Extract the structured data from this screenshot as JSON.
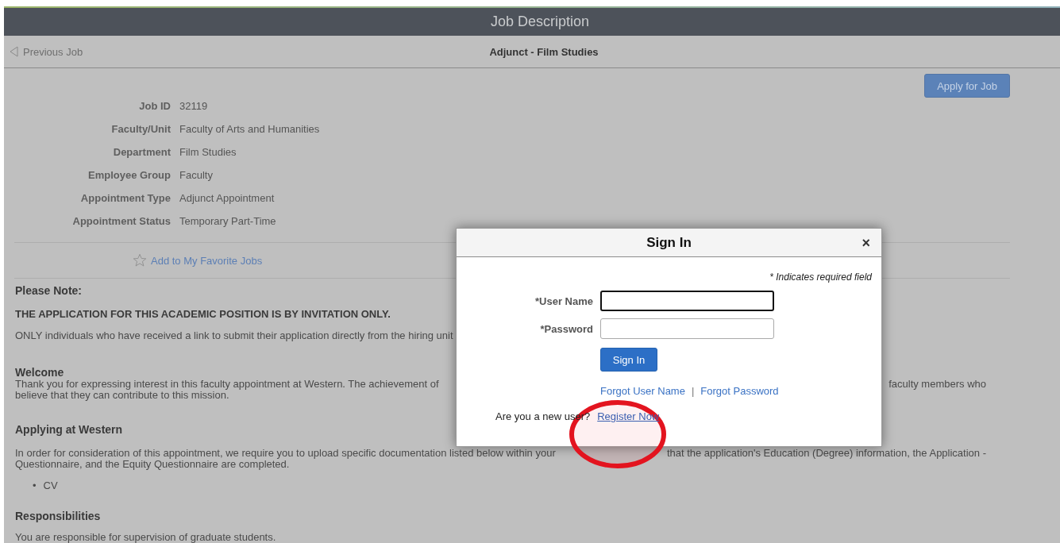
{
  "header": {
    "title": "Job Description"
  },
  "nav": {
    "previous": "Previous Job",
    "job_title": "Adjunct - Film Studies"
  },
  "apply_button": "Apply for Job",
  "details": [
    {
      "label": "Job ID",
      "value": "32119"
    },
    {
      "label": "Faculty/Unit",
      "value": "Faculty of Arts and Humanities"
    },
    {
      "label": "Department",
      "value": "Film Studies"
    },
    {
      "label": "Employee Group",
      "value": "Faculty"
    },
    {
      "label": "Appointment Type",
      "value": "Adjunct Appointment"
    },
    {
      "label": "Appointment Status",
      "value": "Temporary Part-Time"
    }
  ],
  "favorite_link": "Add to My Favorite Jobs",
  "please_note": {
    "heading": "Please Note:",
    "notice": "THE APPLICATION FOR THIS ACADEMIC POSITION IS BY INVITATION ONLY.",
    "text": "ONLY individuals who have received a link to submit their application directly from the hiring unit"
  },
  "welcome": {
    "heading": "Welcome",
    "text_left": "Thank you for expressing interest in this faculty appointment at Western.  The achievement of",
    "text_right": "faculty members who",
    "text_line2": "believe that they can contribute to this mission."
  },
  "applying": {
    "heading": "Applying at Western",
    "text_left": "In order for consideration of this appointment, we require you to upload specific documentation listed below within your",
    "text_right": "that the application's Education (Degree) information, the Application -",
    "text_line2": "Questionnaire, and the Equity Questionnaire are completed.",
    "bullets": [
      {
        "marker": "•",
        "text": "CV"
      }
    ]
  },
  "responsibilities": {
    "heading": "Responsibilities",
    "text": "You are responsible for supervision of graduate students."
  },
  "sign_in": {
    "title": "Sign In",
    "close": "×",
    "required_note": "* Indicates required field",
    "fields": [
      {
        "label": "*User Name",
        "focused": true
      },
      {
        "label": "*Password",
        "focused": false
      }
    ],
    "button": "Sign In",
    "links": [
      "Forgot User Name",
      "Forgot Password"
    ],
    "separator": "|",
    "new_user": "Are you a new user?",
    "register": "Register Now"
  }
}
